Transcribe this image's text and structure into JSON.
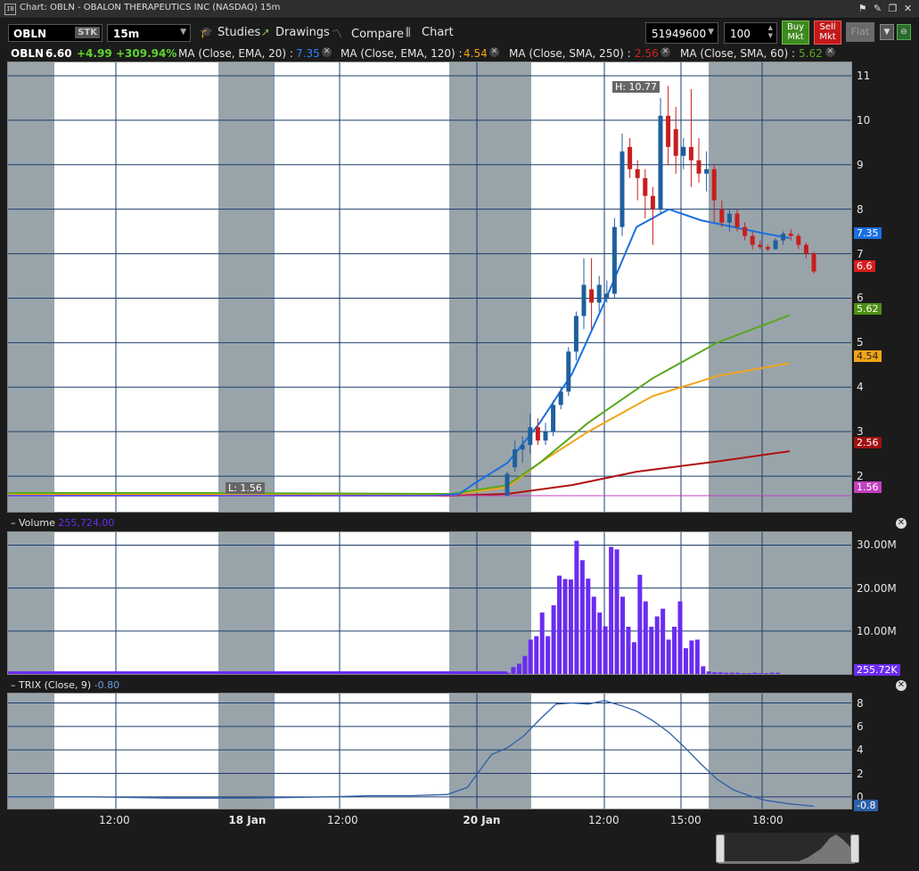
{
  "window": {
    "title": "Chart: OBLN - OBALON THERAPEUTICS INC (NASDAQ) 15m"
  },
  "toolbar": {
    "symbol": "OBLN",
    "sec_type": "STK",
    "timeframe": "15m",
    "studies_label": "Studies",
    "drawings_label": "Drawings",
    "compare_label": "Compare",
    "chart_label": "Chart",
    "account": "51949600",
    "quantity": "100",
    "buy_label": "Buy\nMkt",
    "sell_label": "Sell\nMkt",
    "flat_label": "Flat"
  },
  "legend": {
    "symbol": "OBLN",
    "last": "6.60",
    "change": "+4.99",
    "change_pct": "+309.94%",
    "ma1_label": "MA (Close, EMA, 20) :",
    "ma1_value": "7.35",
    "ma2_label": "MA (Close, EMA, 120) :",
    "ma2_value": "4.54",
    "ma3_label": "MA (Close, SMA, 250) :",
    "ma3_value": "2.56",
    "ma4_label": "MA (Close, SMA, 60) :",
    "ma4_value": "5.62",
    "colors": {
      "up": "#1f5f9e",
      "down": "#c81e1e",
      "ema20": "#1a6fe0",
      "ema120": "#f2a516",
      "sma250": "#b01010",
      "sma60": "#5aa71e",
      "volume": "#6a2cf0",
      "change": "#5fd42e"
    }
  },
  "price_panel": {
    "high_label": "H: 10.77",
    "low_label": "L: 1.56",
    "y_ticks": [
      "11",
      "10",
      "9",
      "8",
      "7",
      "6",
      "5",
      "4",
      "3",
      "2"
    ],
    "tags": {
      "ema20": "7.35",
      "last": "6.6",
      "sma60": "5.62",
      "ema120": "4.54",
      "sma250": "2.56",
      "prev_close": "1.56"
    }
  },
  "volume_panel": {
    "label": "Volume",
    "value": "255,724.00",
    "y_ticks": [
      "30.00M",
      "20.00M",
      "10.00M"
    ],
    "tag": "255.72K"
  },
  "trix_panel": {
    "label": "TRIX (Close, 9)",
    "value": "-0.80",
    "y_ticks": [
      "8",
      "6",
      "4",
      "2",
      "0"
    ],
    "tag": "-0.8"
  },
  "x_axis": {
    "labels": [
      "12:00",
      "18 Jan",
      "12:00",
      "20 Jan",
      "12:00",
      "15:00",
      "18:00"
    ]
  },
  "chart_data": {
    "type": "candlestick",
    "title": "",
    "price_ylim": [
      1.2,
      11.3
    ],
    "candles": [
      {
        "o": 1.56,
        "h": 2.1,
        "l": 1.56,
        "c": 2.05
      },
      {
        "o": 2.2,
        "h": 2.8,
        "l": 2.1,
        "c": 2.6
      },
      {
        "o": 2.6,
        "h": 2.9,
        "l": 2.3,
        "c": 2.7
      },
      {
        "o": 2.7,
        "h": 3.4,
        "l": 2.5,
        "c": 3.1
      },
      {
        "o": 3.1,
        "h": 3.3,
        "l": 2.7,
        "c": 2.8
      },
      {
        "o": 2.8,
        "h": 3.2,
        "l": 2.7,
        "c": 3.0
      },
      {
        "o": 3.0,
        "h": 3.7,
        "l": 2.9,
        "c": 3.6
      },
      {
        "o": 3.6,
        "h": 4.0,
        "l": 3.5,
        "c": 3.9
      },
      {
        "o": 3.9,
        "h": 4.9,
        "l": 3.8,
        "c": 4.8
      },
      {
        "o": 4.8,
        "h": 5.7,
        "l": 4.6,
        "c": 5.6
      },
      {
        "o": 5.6,
        "h": 6.9,
        "l": 5.3,
        "c": 6.3
      },
      {
        "o": 6.2,
        "h": 6.9,
        "l": 5.3,
        "c": 5.9
      },
      {
        "o": 5.9,
        "h": 6.5,
        "l": 5.7,
        "c": 6.3
      },
      {
        "o": 6.0,
        "h": 6.4,
        "l": 5.9,
        "c": 6.1
      },
      {
        "o": 6.1,
        "h": 7.8,
        "l": 6.0,
        "c": 7.6
      },
      {
        "o": 7.6,
        "h": 9.7,
        "l": 7.4,
        "c": 9.3
      },
      {
        "o": 9.4,
        "h": 9.6,
        "l": 8.7,
        "c": 8.9
      },
      {
        "o": 8.9,
        "h": 9.1,
        "l": 8.2,
        "c": 8.7
      },
      {
        "o": 8.7,
        "h": 8.9,
        "l": 7.8,
        "c": 8.3
      },
      {
        "o": 8.3,
        "h": 8.5,
        "l": 7.2,
        "c": 8.0
      },
      {
        "o": 8.0,
        "h": 10.5,
        "l": 7.9,
        "c": 10.1
      },
      {
        "o": 10.1,
        "h": 10.77,
        "l": 9.0,
        "c": 9.4
      },
      {
        "o": 9.8,
        "h": 10.3,
        "l": 8.8,
        "c": 9.2
      },
      {
        "o": 9.2,
        "h": 9.6,
        "l": 8.9,
        "c": 9.4
      },
      {
        "o": 9.4,
        "h": 10.7,
        "l": 8.5,
        "c": 9.1
      },
      {
        "o": 9.1,
        "h": 9.6,
        "l": 8.6,
        "c": 8.8
      },
      {
        "o": 8.8,
        "h": 9.3,
        "l": 8.4,
        "c": 8.9
      },
      {
        "o": 8.9,
        "h": 9.0,
        "l": 7.7,
        "c": 8.2
      },
      {
        "o": 8.0,
        "h": 8.2,
        "l": 7.6,
        "c": 7.7
      },
      {
        "o": 7.7,
        "h": 8.0,
        "l": 7.5,
        "c": 7.9
      },
      {
        "o": 7.9,
        "h": 8.0,
        "l": 7.5,
        "c": 7.6
      },
      {
        "o": 7.6,
        "h": 7.7,
        "l": 7.3,
        "c": 7.4
      },
      {
        "o": 7.4,
        "h": 7.5,
        "l": 7.1,
        "c": 7.2
      },
      {
        "o": 7.2,
        "h": 7.3,
        "l": 7.1,
        "c": 7.15
      },
      {
        "o": 7.15,
        "h": 7.2,
        "l": 7.05,
        "c": 7.1
      },
      {
        "o": 7.1,
        "h": 7.35,
        "l": 7.1,
        "c": 7.3
      },
      {
        "o": 7.3,
        "h": 7.5,
        "l": 7.2,
        "c": 7.45
      },
      {
        "o": 7.45,
        "h": 7.55,
        "l": 7.3,
        "c": 7.4
      },
      {
        "o": 7.4,
        "h": 7.45,
        "l": 7.1,
        "c": 7.2
      },
      {
        "o": 7.2,
        "h": 7.25,
        "l": 6.9,
        "c": 7.0
      },
      {
        "o": 7.0,
        "h": 7.05,
        "l": 6.55,
        "c": 6.6
      }
    ],
    "volume_ylim": [
      0,
      33
    ],
    "volume_millions_pre": [
      0.3,
      1.6,
      2.4,
      4.2,
      8.0,
      8.8,
      14.3,
      8.8,
      16.0,
      22.9,
      22.1,
      22.0,
      31.0,
      26.5,
      22.2,
      18.0,
      14.3,
      11.1,
      29.6,
      29.0,
      18.0,
      11.0,
      7.4,
      23.1,
      16.9,
      11.0,
      13.4,
      15.2,
      8.0,
      11.0,
      16.9,
      6.0,
      7.8,
      8.0,
      1.8,
      0.6,
      0.4,
      0.4,
      0.3,
      0.3,
      0.3,
      0.2,
      0.2,
      0.3,
      0.2,
      0.2,
      0.3,
      0.3
    ],
    "trix_ylim": [
      -1.0,
      8.8
    ],
    "ema20": [
      [
        0.0,
        1.56
      ],
      [
        0.25,
        1.56
      ],
      [
        0.53,
        1.56
      ],
      [
        0.56,
        1.6
      ],
      [
        0.58,
        1.85
      ],
      [
        0.62,
        2.3
      ],
      [
        0.66,
        3.2
      ],
      [
        0.7,
        4.3
      ],
      [
        0.74,
        5.9
      ],
      [
        0.78,
        7.6
      ],
      [
        0.82,
        8.0
      ],
      [
        0.86,
        7.75
      ],
      [
        0.9,
        7.6
      ],
      [
        0.94,
        7.45
      ],
      [
        0.97,
        7.35
      ]
    ],
    "sma60": [
      [
        0.0,
        1.62
      ],
      [
        0.25,
        1.62
      ],
      [
        0.55,
        1.6
      ],
      [
        0.62,
        1.8
      ],
      [
        0.66,
        2.3
      ],
      [
        0.72,
        3.2
      ],
      [
        0.8,
        4.2
      ],
      [
        0.88,
        5.0
      ],
      [
        0.97,
        5.62
      ]
    ],
    "ema120": [
      [
        0.0,
        1.58
      ],
      [
        0.25,
        1.6
      ],
      [
        0.55,
        1.58
      ],
      [
        0.62,
        1.75
      ],
      [
        0.66,
        2.3
      ],
      [
        0.72,
        3.0
      ],
      [
        0.8,
        3.8
      ],
      [
        0.88,
        4.25
      ],
      [
        0.97,
        4.54
      ]
    ],
    "sma250": [
      [
        0.0,
        1.56
      ],
      [
        0.55,
        1.56
      ],
      [
        0.62,
        1.6
      ],
      [
        0.7,
        1.8
      ],
      [
        0.78,
        2.1
      ],
      [
        0.88,
        2.33
      ],
      [
        0.97,
        2.56
      ]
    ],
    "trix": [
      [
        0.0,
        0.0
      ],
      [
        0.1,
        0.0
      ],
      [
        0.2,
        -0.1
      ],
      [
        0.3,
        -0.1
      ],
      [
        0.4,
        0.0
      ],
      [
        0.45,
        0.1
      ],
      [
        0.5,
        0.1
      ],
      [
        0.545,
        0.2
      ],
      [
        0.57,
        0.8
      ],
      [
        0.585,
        2.2
      ],
      [
        0.6,
        3.6
      ],
      [
        0.62,
        4.2
      ],
      [
        0.64,
        5.2
      ],
      [
        0.66,
        6.6
      ],
      [
        0.68,
        7.9
      ],
      [
        0.7,
        8.0
      ],
      [
        0.72,
        7.9
      ],
      [
        0.74,
        8.2
      ],
      [
        0.76,
        7.8
      ],
      [
        0.78,
        7.3
      ],
      [
        0.8,
        6.5
      ],
      [
        0.82,
        5.5
      ],
      [
        0.84,
        4.2
      ],
      [
        0.86,
        2.8
      ],
      [
        0.88,
        1.5
      ],
      [
        0.9,
        0.6
      ],
      [
        0.92,
        0.1
      ],
      [
        0.94,
        -0.3
      ],
      [
        0.97,
        -0.6
      ],
      [
        1.0,
        -0.8
      ]
    ]
  }
}
